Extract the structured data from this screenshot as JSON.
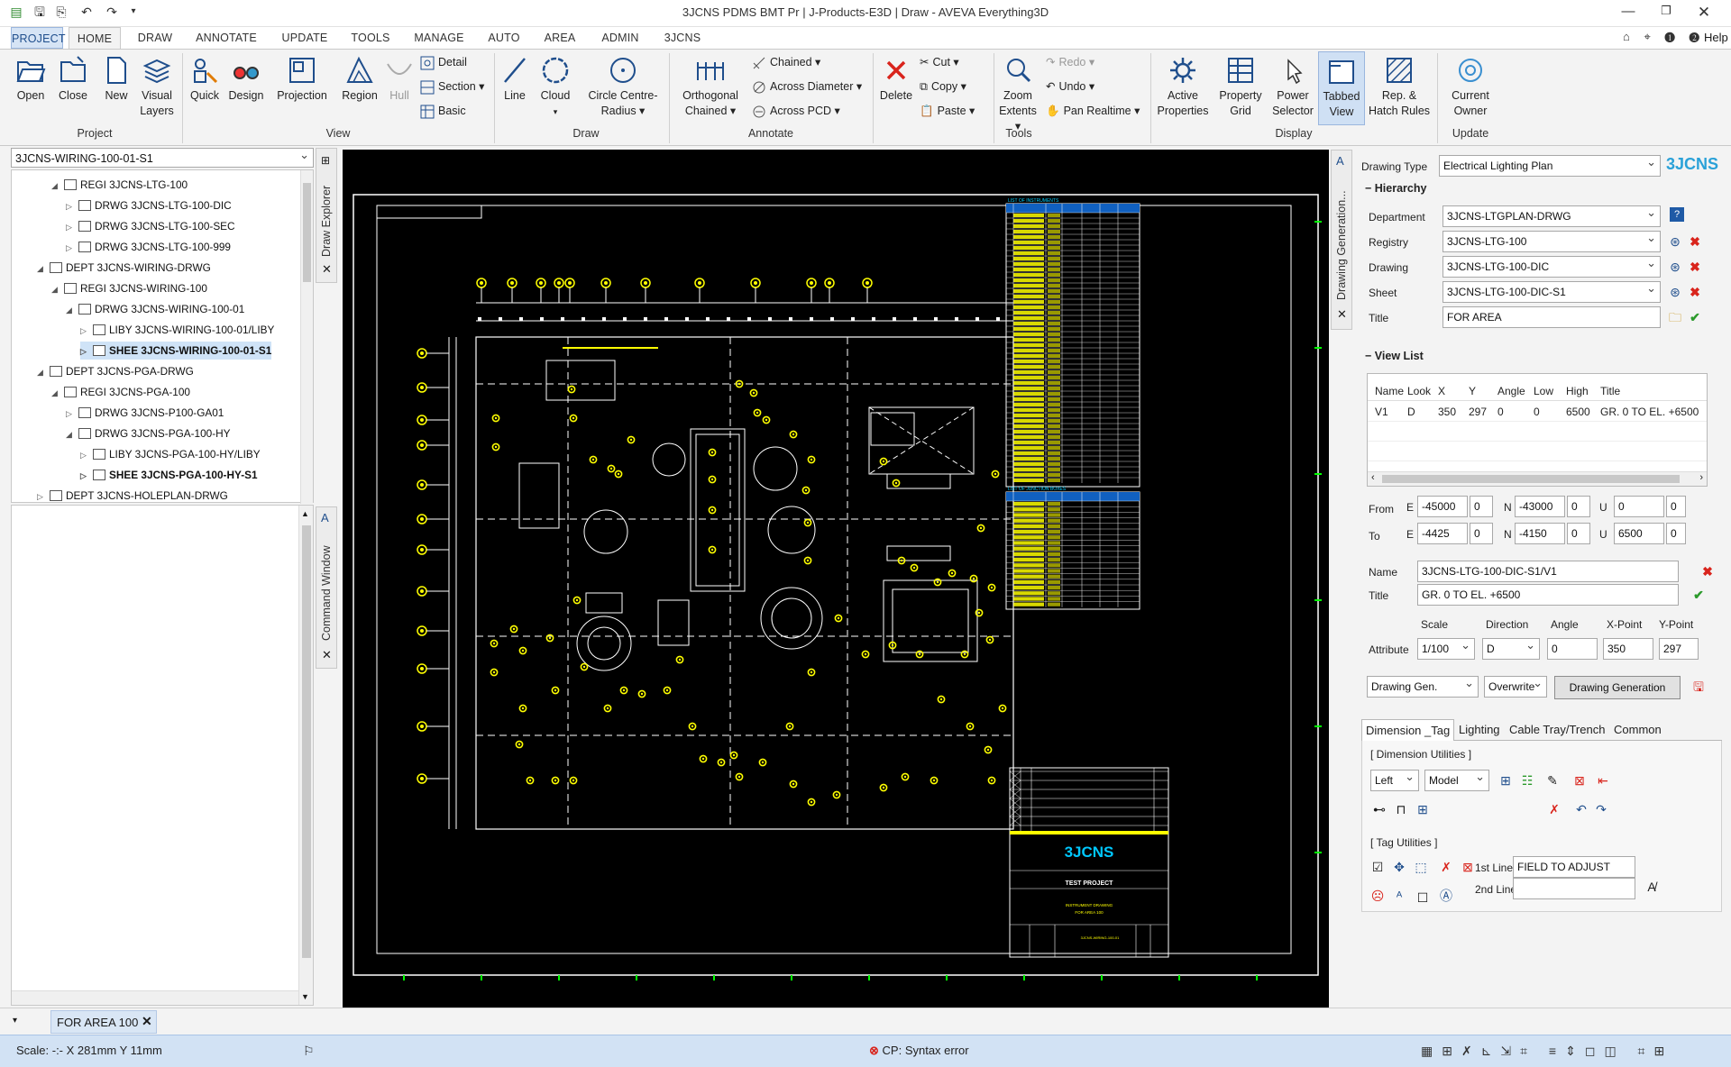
{
  "window": {
    "title": "3JCNS PDMS BMT Pr | J-Products-E3D | Draw - AVEVA Everything3D",
    "help": "Help"
  },
  "tabs": [
    "PROJECT",
    "HOME",
    "DRAW",
    "ANNOTATE",
    "UPDATE",
    "TOOLS",
    "MANAGE",
    "AUTO",
    "AREA",
    "ADMIN",
    "3JCNS"
  ],
  "ribbon": {
    "project": {
      "open": "Open",
      "close": "Close",
      "new": "New",
      "visual_layers_1": "Visual",
      "visual_layers_2": "Layers",
      "group": "Project"
    },
    "view": {
      "quick": "Quick",
      "design": "Design",
      "projection": "Projection",
      "region": "Region",
      "hull": "Hull",
      "detail": "Detail",
      "section": "Section",
      "basic": "Basic",
      "group": "View"
    },
    "draw": {
      "line": "Line",
      "cloud": "Cloud",
      "circle_1": "Circle Centre-",
      "circle_2": "Radius",
      "group": "Draw"
    },
    "annotate": {
      "ortho_1": "Orthogonal",
      "ortho_2": "Chained",
      "chained": "Chained",
      "across_diameter": "Across Diameter",
      "across_pcd": "Across PCD",
      "group": "Annotate"
    },
    "edit": {
      "delete": "Delete",
      "cut": "Cut",
      "copy": "Copy",
      "paste": "Paste"
    },
    "tools": {
      "zoom_1": "Zoom",
      "zoom_2": "Extents",
      "redo": "Redo",
      "undo": "Undo",
      "pan": "Pan Realtime",
      "group": "Tools"
    },
    "display": {
      "active_1": "Active",
      "active_2": "Properties",
      "pgrid_1": "Property",
      "pgrid_2": "Grid",
      "power_1": "Power",
      "power_2": "Selector",
      "tabbed_1": "Tabbed",
      "tabbed_2": "View",
      "rep_1": "Rep. &",
      "rep_2": "Hatch Rules",
      "group": "Display"
    },
    "update": {
      "owner_1": "Current",
      "owner_2": "Owner",
      "group": "Update"
    }
  },
  "explorer": {
    "selector": "3JCNS-WIRING-100-01-S1",
    "vtab": "Draw Explorer",
    "items": [
      {
        "label": "REGI 3JCNS-LTG-100",
        "indent": 2,
        "exp": "◢"
      },
      {
        "label": "DRWG 3JCNS-LTG-100-DIC",
        "indent": 3,
        "exp": "▷"
      },
      {
        "label": "DRWG 3JCNS-LTG-100-SEC",
        "indent": 3,
        "exp": "▷"
      },
      {
        "label": "DRWG 3JCNS-LTG-100-999",
        "indent": 3,
        "exp": "▷"
      },
      {
        "label": "DEPT 3JCNS-WIRING-DRWG",
        "indent": 1,
        "exp": "◢"
      },
      {
        "label": "REGI 3JCNS-WIRING-100",
        "indent": 2,
        "exp": "◢"
      },
      {
        "label": "DRWG 3JCNS-WIRING-100-01",
        "indent": 3,
        "exp": "◢"
      },
      {
        "label": "LIBY 3JCNS-WIRING-100-01/LIBY",
        "indent": 4,
        "exp": "▷"
      },
      {
        "label": "SHEE 3JCNS-WIRING-100-01-S1",
        "indent": 4,
        "exp": "▷",
        "sel": true
      },
      {
        "label": "DEPT 3JCNS-PGA-DRWG",
        "indent": 1,
        "exp": "◢"
      },
      {
        "label": "REGI 3JCNS-PGA-100",
        "indent": 2,
        "exp": "◢"
      },
      {
        "label": "DRWG 3JCNS-P100-GA01",
        "indent": 3,
        "exp": "▷"
      },
      {
        "label": "DRWG 3JCNS-PGA-100-HY",
        "indent": 3,
        "exp": "◢"
      },
      {
        "label": "LIBY 3JCNS-PGA-100-HY/LIBY",
        "indent": 4,
        "exp": "▷"
      },
      {
        "label": "SHEE 3JCNS-PGA-100-HY-S1",
        "indent": 4,
        "exp": "▷",
        "bold": true
      },
      {
        "label": "DEPT 3JCNS-HOLEPLAN-DRWG",
        "indent": 1,
        "exp": "▷"
      }
    ]
  },
  "command_window": {
    "vtab": "Command Window"
  },
  "canvas": {
    "logo": "3JCNS",
    "project": "TEST PROJECT",
    "drawing_title_1": "INSTRUMENT DRAWING",
    "drawing_title_2": "FOR AREA 100",
    "drawing_no": "3JCNS-WIRING-100-01",
    "schedule_1": "LIST OF INSTRUMENTS",
    "schedule_2": "LIST OF JUNCTION BOXES"
  },
  "panel": {
    "vtab": "Drawing Generation...",
    "logo": "3JCNS",
    "drawing_type_label": "Drawing Type",
    "drawing_type": "Electrical Lighting Plan",
    "hierarchy": "Hierarchy",
    "department_label": "Department",
    "department": "3JCNS-LTGPLAN-DRWG",
    "registry_label": "Registry",
    "registry": "3JCNS-LTG-100",
    "drawing_label": "Drawing",
    "drawing": "3JCNS-LTG-100-DIC",
    "sheet_label": "Sheet",
    "sheet": "3JCNS-LTG-100-DIC-S1",
    "title_label": "Title",
    "title": "FOR AREA",
    "view_list": "View List",
    "view_cols": [
      "Name",
      "Look",
      "X",
      "Y",
      "Angle",
      "Low",
      "High",
      "Title"
    ],
    "view_rows": [
      [
        "V1",
        "D",
        "350",
        "297",
        "0",
        "0",
        "6500",
        "GR. 0 TO EL. +6500"
      ]
    ],
    "from_label": "From",
    "to_label": "To",
    "e": "E",
    "n": "N",
    "u": "U",
    "from_e": "-45000",
    "from_e2": "0",
    "from_n": "-43000",
    "from_n2": "0",
    "from_u": "0",
    "from_u2": "0",
    "to_e": "-4425",
    "to_e2": "0",
    "to_n": "-4150",
    "to_n2": "0",
    "to_u": "6500",
    "to_u2": "0",
    "name_label": "Name",
    "name": "3JCNS-LTG-100-DIC-S1/V1",
    "vtitle_label": "Title",
    "vtitle": "GR. 0 TO EL. +6500",
    "scale_h": "Scale",
    "direction_h": "Direction",
    "angle_h": "Angle",
    "xpoint_h": "X-Point",
    "ypoint_h": "Y-Point",
    "attribute_label": "Attribute",
    "scale": "1/100",
    "direction": "D",
    "angle": "0",
    "xpoint": "350",
    "ypoint": "297",
    "gen_mode": "Drawing Gen.",
    "overwrite": "Overwrite",
    "gen_button": "Drawing Generation",
    "subtabs": [
      "Dimension _Tag",
      "Lighting",
      "Cable Tray/Trench",
      "Common"
    ],
    "dim_utils": "[ Dimension Utilities ]",
    "dim_side": "Left",
    "dim_space": "Model",
    "tag_utils": "[ Tag Utilities ]",
    "first_line_label": "1st Line",
    "first_line": "FIELD TO ADJUST",
    "second_line_label": "2nd Line",
    "second_line": ""
  },
  "doc_tab": "FOR AREA 100",
  "status": {
    "scale": "Scale: -:-   X 281mm Y 11mm",
    "error": "CP: Syntax error"
  },
  "colors": {
    "accent": "#1f4e8c",
    "canvas_bg": "#000000",
    "cad_yellow": "#ffff00",
    "cad_white": "#ffffff",
    "error": "#d9241c"
  }
}
